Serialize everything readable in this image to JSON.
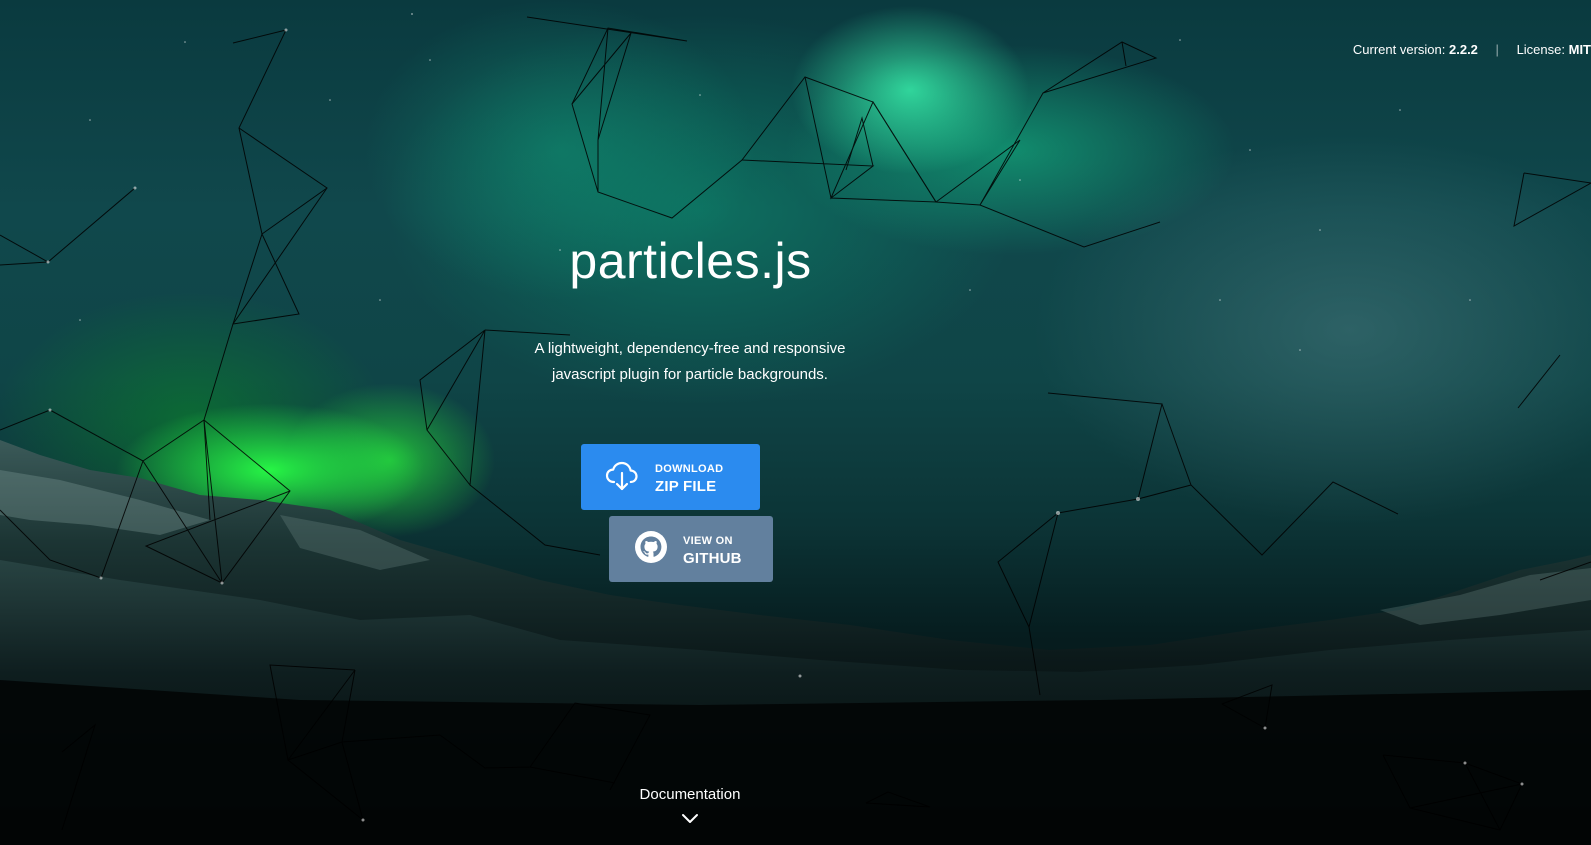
{
  "header": {
    "version_label": "Current version:",
    "version_value": "2.2.2",
    "license_label": "License:",
    "license_value": "MIT"
  },
  "hero": {
    "title": "particles.js",
    "subtitle_line1": "A lightweight, dependency-free and responsive",
    "subtitle_line2": "javascript plugin for particle backgrounds."
  },
  "buttons": {
    "download": {
      "line1": "DOWNLOAD",
      "line2": "ZIP FILE",
      "icon": "cloud-download-icon",
      "color": "#2b8bef"
    },
    "github": {
      "line1": "VIEW ON",
      "line2": "GITHUB",
      "icon": "github-icon",
      "color": "#62809e"
    }
  },
  "footer": {
    "docs_label": "Documentation",
    "docs_icon": "chevron-down-icon"
  },
  "colors": {
    "particle_lines": "#000000",
    "text": "#ffffff"
  }
}
